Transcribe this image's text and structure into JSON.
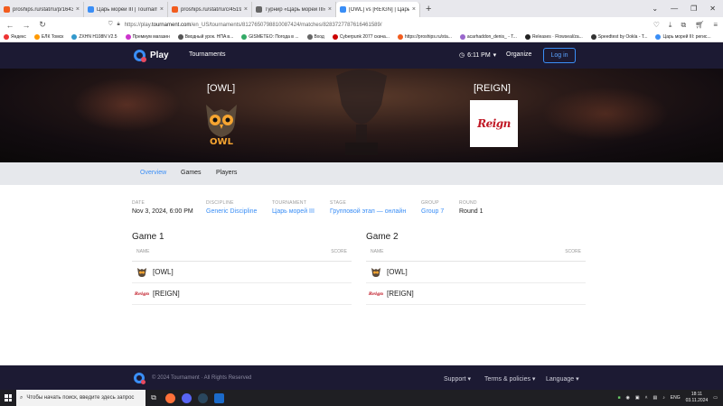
{
  "browser": {
    "tabs": [
      {
        "title": "proships.ru/stat/ru/p/1643837/",
        "color": "#f25c1e"
      },
      {
        "title": "Царь морей III | Tournament",
        "color": "#3a8ef6"
      },
      {
        "title": "proships.ru/stat/ru/c/451982-С",
        "color": "#f25c1e"
      },
      {
        "title": "Турнир «Царь морей III» — Гу",
        "color": "#666666"
      },
      {
        "title": "[OWL] vs [REIGN] | Царь море",
        "color": "#3a8ef6",
        "active": true
      }
    ],
    "url_prefix": "https://play.",
    "url_host": "tournament.com",
    "url_path": "/en_US/tournaments/8127650798810087424/matches/8283727787616461589/",
    "bookmarks": [
      "Яндекс",
      "ЕЛК Томск",
      "ZXHN H108N V2.5",
      "Премиум магазин",
      "Вводный урок. HПA в...",
      "GISMETEO: Погода в ...",
      "Вход",
      "Cyberpunk 2077 скача...",
      "https://proships.ru/sta...",
      "acarhaddon_denis_ - Т...",
      "Releases · Flowseal/za...",
      "Speedtest by Ookla - T...",
      "Царь морей III: регис..."
    ]
  },
  "header": {
    "brand": "Play",
    "nav_tournaments": "Tournaments",
    "time": "6:11 PM",
    "organize": "Organize",
    "login": "Log in"
  },
  "match": {
    "team1": "[OWL]",
    "team2": "[REIGN]",
    "team1_logo_text": "OWL",
    "team2_logo_text": "Reign"
  },
  "tabs": [
    "Overview",
    "Games",
    "Players"
  ],
  "info": {
    "date_label": "DATE",
    "date": "Nov 3, 2024, 6:00 PM",
    "discipline_label": "DISCIPLINE",
    "discipline": "Generic Discipline",
    "tournament_label": "TOURNAMENT",
    "tournament": "Царь морей III",
    "stage_label": "STAGE",
    "stage": "Групповой этап — онлайн",
    "group_label": "GROUP",
    "group": "Group 7",
    "round_label": "ROUND",
    "round": "Round 1"
  },
  "games": [
    {
      "title": "Game 1",
      "name_header": "NAME",
      "score_header": "SCORE",
      "team1": "[OWL]",
      "team2": "[REIGN]"
    },
    {
      "title": "Game 2",
      "name_header": "NAME",
      "score_header": "SCORE",
      "team1": "[OWL]",
      "team2": "[REIGN]"
    }
  ],
  "footer": {
    "copyright": "© 2024 Tournament · All Rights Reserved",
    "support": "Support",
    "terms": "Terms & policies",
    "language": "Language"
  },
  "taskbar": {
    "search_placeholder": "Чтобы начать поиск, введите здесь запрос",
    "lang": "ENG",
    "time": "18:11",
    "date": "03.11.2024"
  }
}
